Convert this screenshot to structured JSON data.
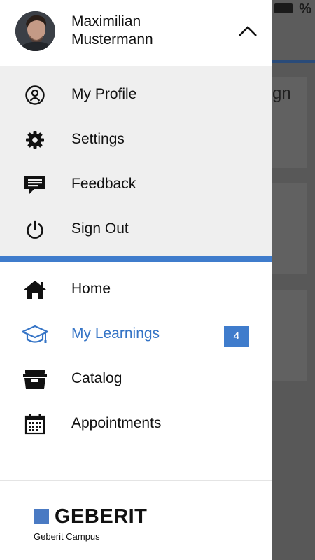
{
  "background": {
    "status_pct": "%",
    "card_text": "gn"
  },
  "user": {
    "first_name": "Maximilian",
    "last_name": "Mustermann"
  },
  "account_menu": [
    {
      "label": "My Profile",
      "icon": "user-circle-icon"
    },
    {
      "label": "Settings",
      "icon": "gear-icon"
    },
    {
      "label": "Feedback",
      "icon": "message-icon"
    },
    {
      "label": "Sign Out",
      "icon": "power-icon"
    }
  ],
  "nav_menu": [
    {
      "label": "Home",
      "icon": "home-icon",
      "active": false
    },
    {
      "label": "My Learnings",
      "icon": "graduation-cap-icon",
      "active": true,
      "badge": "4"
    },
    {
      "label": "Catalog",
      "icon": "archive-box-icon",
      "active": false
    },
    {
      "label": "Appointments",
      "icon": "calendar-icon",
      "active": false
    }
  ],
  "footer": {
    "logo_text": "GEBERIT",
    "subtitle": "Geberit Campus"
  },
  "colors": {
    "accent": "#3f7ccc",
    "active_text": "#3574c6",
    "menu_bg": "#efefef"
  }
}
